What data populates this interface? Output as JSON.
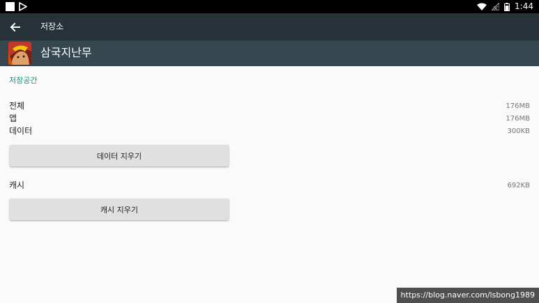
{
  "status_bar": {
    "time": "1:44",
    "icons": [
      "notification-square-icon",
      "play-store-icon",
      "wifi-icon",
      "no-signal-icon",
      "battery-icon"
    ]
  },
  "toolbar": {
    "back_icon": "arrow-left-icon",
    "title": "저장소"
  },
  "app": {
    "name": "삼국지난무",
    "icon": "app-icon"
  },
  "storage": {
    "section_title": "저장공간",
    "rows": [
      {
        "label": "전체",
        "value": "176MB"
      },
      {
        "label": "앱",
        "value": "176MB"
      },
      {
        "label": "데이터",
        "value": "300KB"
      }
    ],
    "clear_data_label": "데이터 지우기"
  },
  "cache": {
    "label": "캐시",
    "value": "692KB",
    "clear_cache_label": "캐시 지우기"
  },
  "watermark": "https://blog.naver.com/lsbong1989",
  "colors": {
    "toolbar": "#263238",
    "app_header": "#37474f",
    "accent": "#009688",
    "button": "#e0e0e0",
    "background": "#fafafa"
  }
}
